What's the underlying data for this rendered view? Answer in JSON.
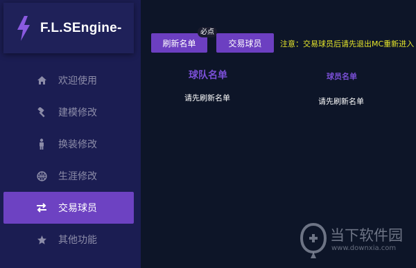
{
  "app": {
    "title": "F.L.SEngine-"
  },
  "sidebar": {
    "items": [
      {
        "label": "欢迎使用",
        "icon": "home-icon",
        "active": false
      },
      {
        "label": "建模修改",
        "icon": "hammer-icon",
        "active": false
      },
      {
        "label": "换装修改",
        "icon": "person-icon",
        "active": false
      },
      {
        "label": "生涯修改",
        "icon": "basketball-icon",
        "active": false
      },
      {
        "label": "交易球员",
        "icon": "swap-icon",
        "active": true
      },
      {
        "label": "其他功能",
        "icon": "star-icon",
        "active": false
      }
    ]
  },
  "toolbar": {
    "refresh_label": "刷新名单",
    "refresh_badge": "必点",
    "trade_label": "交易球员",
    "notice": "注意：交易球员后请先退出MC重新进入"
  },
  "team_panel": {
    "title": "球队名单",
    "empty_text": "请先刷新名单"
  },
  "players_panel": {
    "title": "球员名单",
    "empty_text": "请先刷新名单"
  },
  "watermark": {
    "name": "当下软件园",
    "url": "www.downxia.com"
  },
  "colors": {
    "sidebar_bg": "#1b1d52",
    "main_bg": "#0d1528",
    "accent": "#6c3fc1",
    "notice": "#e6e62a"
  }
}
